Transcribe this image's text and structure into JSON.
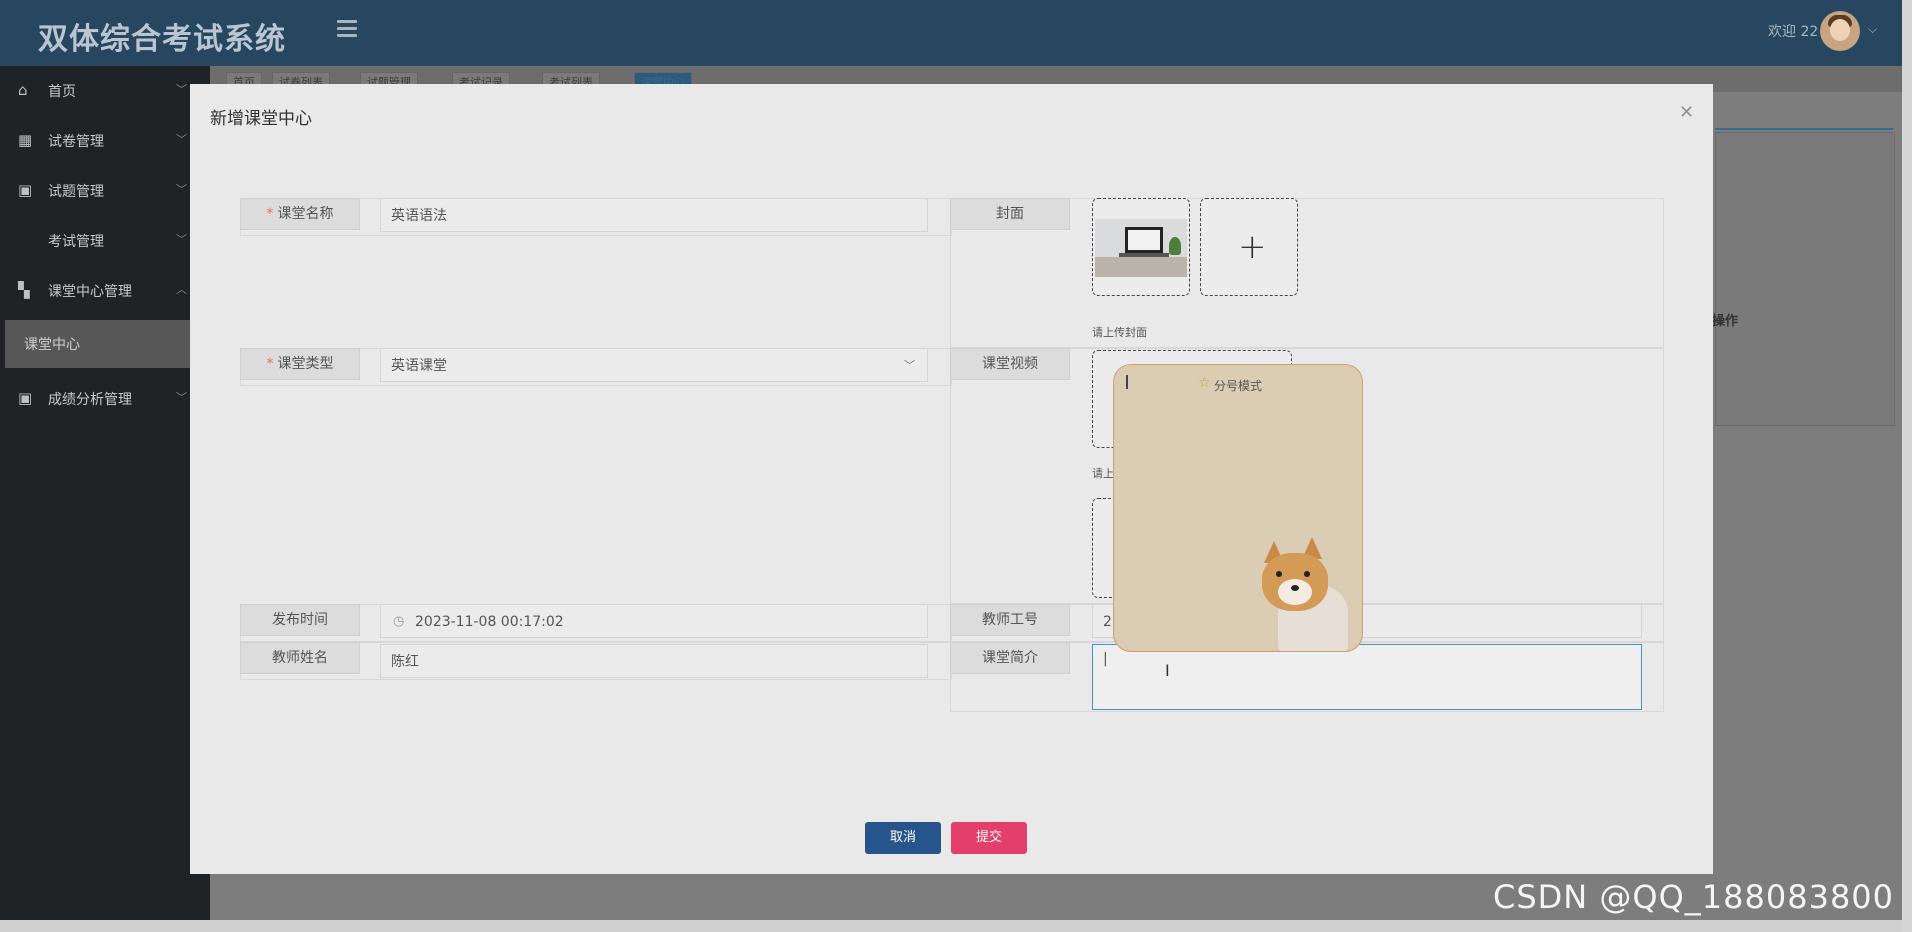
{
  "header": {
    "app_title": "双体综合考试系统",
    "welcome": "欢迎 22"
  },
  "sidebar": {
    "items": [
      {
        "label": "首页",
        "icon": "home-icon"
      },
      {
        "label": "试卷管理",
        "icon": "grid-icon"
      },
      {
        "label": "试题管理",
        "icon": "briefcase-icon"
      },
      {
        "label": "考试管理",
        "icon": ""
      },
      {
        "label": "课堂中心管理",
        "icon": "dashboard-icon"
      },
      {
        "label": "成绩分析管理",
        "icon": "briefcase-icon"
      }
    ],
    "active_sub": "课堂中心"
  },
  "bg_tabs": [
    "首页",
    "试卷列表",
    "试题管理",
    "考试记录",
    "考试列表",
    "课堂中心"
  ],
  "bg_table": {
    "op_header": "操作"
  },
  "modal": {
    "title": "新增课堂中心",
    "fields": {
      "course_name": {
        "label": "课堂名称",
        "value": "英语语法"
      },
      "course_type": {
        "label": "课堂类型",
        "value": "英语课堂"
      },
      "publish_time": {
        "label": "发布时间",
        "value": "2023-11-08 00:17:02"
      },
      "teacher_name": {
        "label": "教师姓名",
        "value": "陈红"
      },
      "cover": {
        "label": "封面",
        "hint": "请上传封面"
      },
      "video": {
        "label": "课堂视频",
        "hint": "请上"
      },
      "teacher_id": {
        "label": "教师工号",
        "value": "2"
      },
      "intro": {
        "label": "课堂简介",
        "value": "|"
      }
    },
    "buttons": {
      "cancel": "取消",
      "submit": "提交"
    }
  },
  "popup": {
    "title": "分号模式"
  },
  "watermark": "CSDN @QQ_188083800"
}
